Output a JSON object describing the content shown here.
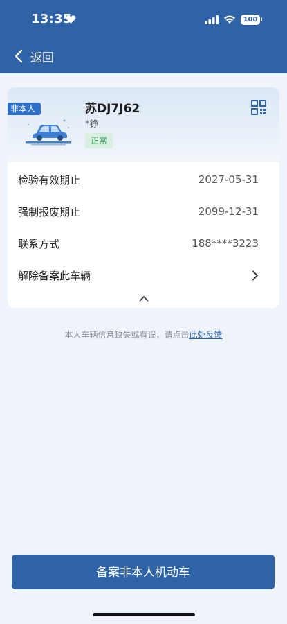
{
  "status_bar": {
    "time": "13:35",
    "battery": "100"
  },
  "nav": {
    "back_label": "返回"
  },
  "vehicle": {
    "owner_badge": "非本人",
    "plate": "苏DJ7J62",
    "owner_name": "*铮",
    "status": "正常"
  },
  "details": [
    {
      "label": "检验有效期止",
      "value": "2027-05-31"
    },
    {
      "label": "强制报废期止",
      "value": "2099-12-31"
    },
    {
      "label": "联系方式",
      "value": "188****3223"
    },
    {
      "label": "解除备案此车辆",
      "value": ""
    }
  ],
  "feedback": {
    "text": "本人车辆信息缺失或有误，请点击",
    "link": "此处反馈"
  },
  "footer": {
    "register_label": "备案非本人机动车"
  },
  "colors": {
    "primary": "#2e63a8",
    "status_green": "#3aa563",
    "background": "#eef4f9"
  },
  "icons": [
    "heart-icon",
    "signal-icon",
    "wifi-icon",
    "back-chevron-icon",
    "qr-code-icon",
    "car-icon",
    "chevron-right-icon",
    "chevron-up-icon"
  ]
}
